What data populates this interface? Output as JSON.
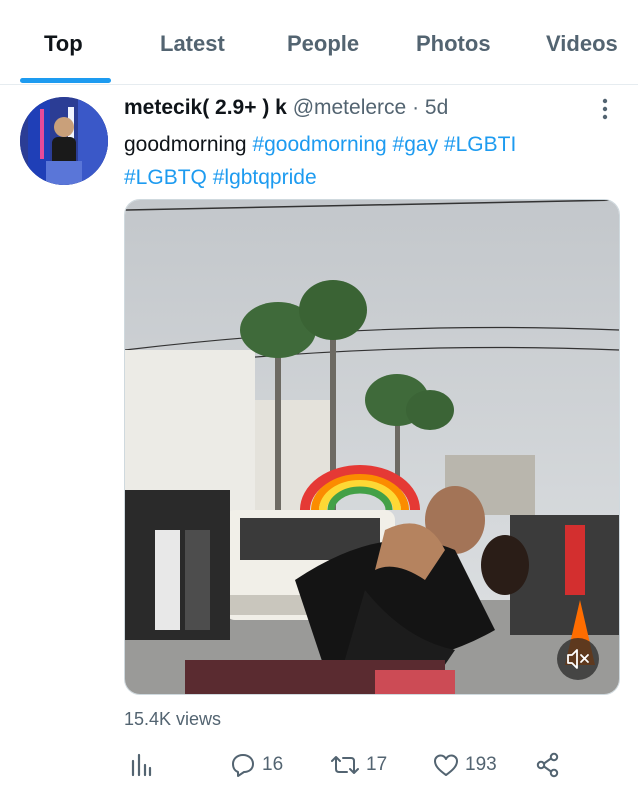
{
  "tabs": [
    {
      "label": "Top",
      "active": true
    },
    {
      "label": "Latest",
      "active": false
    },
    {
      "label": "People",
      "active": false
    },
    {
      "label": "Photos",
      "active": false
    },
    {
      "label": "Videos",
      "active": false
    }
  ],
  "tweet": {
    "display_name": "metecik( 2.9+ ) k",
    "handle": "@metelerce",
    "separator": "·",
    "time": "5d",
    "text_plain": "goodmorning",
    "hashtags": [
      "#goodmorning",
      "#gay",
      "#LGBTI",
      "#LGBTQ",
      "#lgbtqpride"
    ],
    "media": {
      "type": "video",
      "muted": true
    },
    "views": "15.4K views"
  },
  "actions": {
    "analytics": "analytics-icon",
    "reply_count": "16",
    "retweet_count": "17",
    "like_count": "193",
    "share": "share-icon"
  },
  "colors": {
    "accent": "#1d9bf0",
    "text_primary": "#0f1419",
    "text_secondary": "#536471",
    "divider": "#e6ecf0"
  }
}
